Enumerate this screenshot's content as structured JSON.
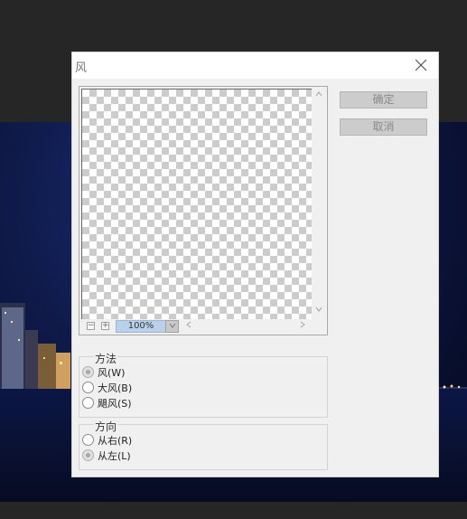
{
  "dialog": {
    "title": "风",
    "ok_label": "确定",
    "cancel_label": "取消"
  },
  "preview": {
    "zoom": "100%",
    "zoom_out_label": "−",
    "zoom_in_label": "+"
  },
  "method": {
    "title": "方法",
    "options": [
      {
        "label": "风(W)",
        "checked": true
      },
      {
        "label": "大风(B)",
        "checked": false
      },
      {
        "label": "飓风(S)",
        "checked": false
      }
    ]
  },
  "direction": {
    "title": "方向",
    "options": [
      {
        "label": "从右(R)",
        "checked": false
      },
      {
        "label": "从左(L)",
        "checked": true
      }
    ]
  },
  "icons": {
    "close": "close-icon",
    "scroll_up": "chevron-up-icon",
    "scroll_down": "chevron-down-icon",
    "scroll_left": "chevron-left-icon",
    "scroll_right": "chevron-right-icon",
    "zoom_dropdown": "chevron-down-icon"
  },
  "colors": {
    "canvas_bg": "#262626",
    "dialog_bg": "#f0f0f0",
    "button_bg": "#cccccc",
    "zoom_field_bg": "#b9d1ea"
  }
}
